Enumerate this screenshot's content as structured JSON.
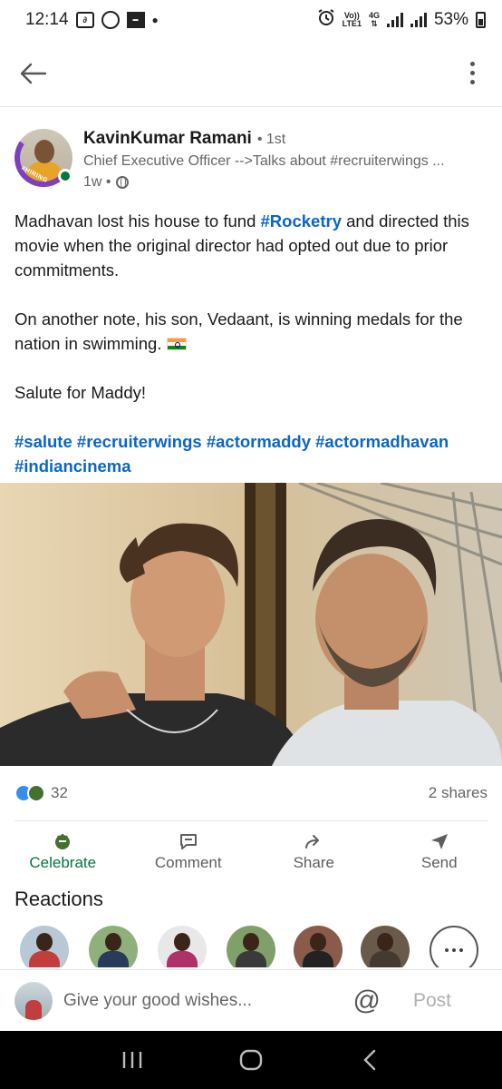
{
  "status_bar": {
    "time": "12:14",
    "network_line1": "Vo))",
    "network_line2": "LTE1",
    "network_gen": "4G",
    "battery": "53%"
  },
  "post": {
    "author_name": "KavinKumar Ramani",
    "degree": "• 1st",
    "headline": "Chief Executive Officer -->Talks about #recruiterwings ...",
    "time": "1w •",
    "hiring_badge": "#HIRING",
    "body": {
      "p1_before": "Madhavan lost his house to fund ",
      "p1_hashtag": "#Rocketry",
      "p1_after": " and directed this movie when the original director had opted out due to prior commitments.",
      "p2": "On another note, his son, Vedaant, is winning medals for the nation in swimming.",
      "p3": "Salute for Maddy!",
      "hashtags": [
        "#salute",
        "#recruiterwings",
        "#actormaddy",
        "#actormadhavan",
        "#indiancinema"
      ]
    }
  },
  "social": {
    "reactions_count": "32",
    "shares": "2 shares"
  },
  "actions": {
    "celebrate": "Celebrate",
    "comment": "Comment",
    "share": "Share",
    "send": "Send"
  },
  "reactions_title": "Reactions",
  "comment_bar": {
    "placeholder": "Give your good wishes...",
    "at": "@",
    "post_label": "Post"
  },
  "colors": {
    "link_blue": "#0a66c2",
    "celebrate_green": "#057642",
    "hiring_purple": "#7d3fbd"
  }
}
